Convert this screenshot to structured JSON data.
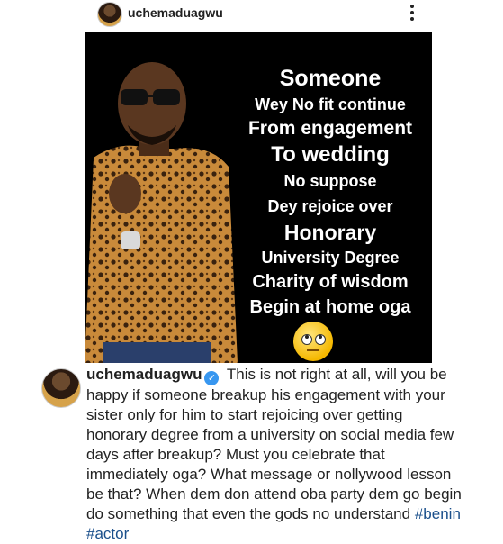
{
  "header": {
    "username": "uchemaduagwu",
    "more_icon": "more-vertical-icon"
  },
  "post_image": {
    "lines": [
      "Someone",
      "Wey  No fit continue",
      "From engagement",
      "To wedding",
      "No suppose",
      "Dey rejoice over",
      "Honorary",
      "University Degree",
      "Charity of wisdom",
      "Begin at home oga"
    ],
    "emoji": "rolling-eyes-emoji"
  },
  "comment": {
    "username": "uchemaduagwu",
    "verified_icon": "verified-badge-icon",
    "text": "This is not right at all, will you be happy if someone breakup his engagement with your sister only for him to start rejoicing over getting honorary degree from a university on social media few days after breakup? Must you celebrate that immediately oga? What message or nollywood lesson be that? When dem don attend oba party dem go begin do something that even the gods no understand",
    "hashtags": [
      "#benin",
      "#actor"
    ]
  },
  "colors": {
    "background": "#ffffff",
    "image_background": "#000000",
    "verified": "#3897f0",
    "hashtag": "#1a4f8b"
  }
}
